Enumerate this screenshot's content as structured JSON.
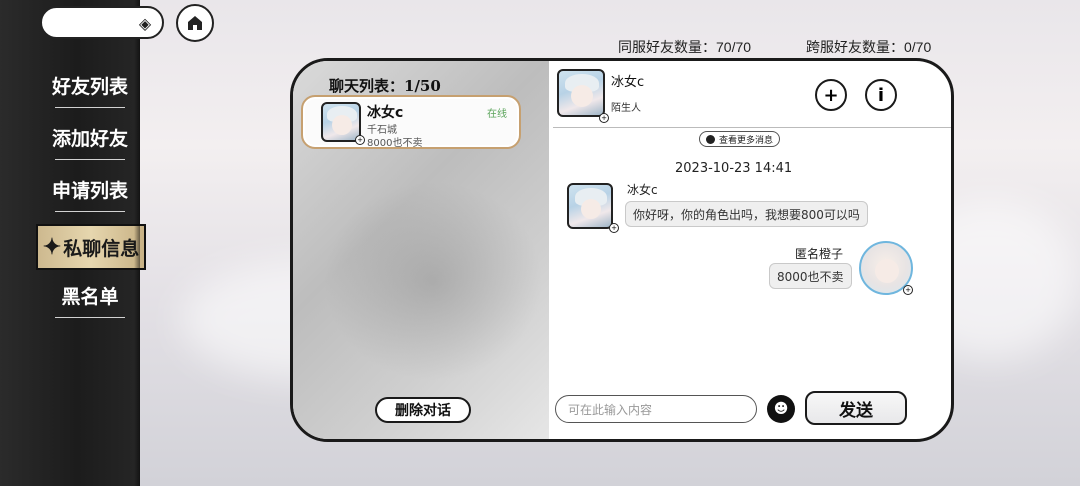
{
  "sidebar": {
    "items": [
      {
        "label": "好友列表"
      },
      {
        "label": "添加好友"
      },
      {
        "label": "申请列表"
      },
      {
        "label": "私聊信息"
      },
      {
        "label": "黑名单"
      }
    ]
  },
  "counts": {
    "same_server": "同服好友数量：70/70",
    "cross_server": "跨服好友数量：0/70"
  },
  "chat_list": {
    "title": "聊天列表：1/50",
    "items": [
      {
        "name": "冰女c",
        "sub": "千石城",
        "last_message": "8000也不卖",
        "status": "在线"
      }
    ],
    "delete_label": "删除对话"
  },
  "chat": {
    "header_name": "冰女c",
    "header_sub": "陌生人",
    "more_messages": "查看更多消息",
    "timestamp": "2023-10-23 14:41",
    "messages": [
      {
        "sender": "冰女c",
        "text": "你好呀，你的角色出吗，我想要800可以吗"
      },
      {
        "sender": "匿名橙子",
        "text": "8000也不卖"
      }
    ],
    "input_placeholder": "可在此输入内容",
    "send_label": "发送"
  },
  "icons": {
    "add": "+",
    "info": "i"
  }
}
